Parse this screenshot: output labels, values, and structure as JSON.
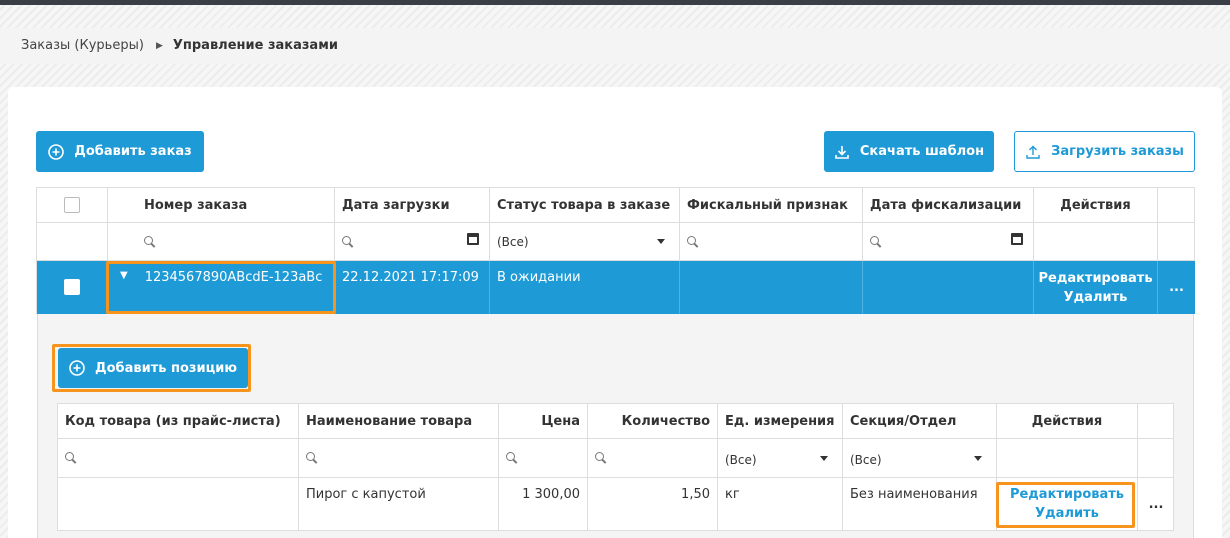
{
  "breadcrumb": {
    "parent": "Заказы (Курьеры)",
    "current": "Управление заказами"
  },
  "toolbar": {
    "add_order": "Добавить заказ",
    "download_template": "Скачать шаблон",
    "upload_orders": "Загрузить заказы"
  },
  "orders_table": {
    "columns": [
      "Номер заказа",
      "Дата загрузки",
      "Статус товара в заказе",
      "Фискальный признак",
      "Дата фискализации",
      "Действия"
    ],
    "sort_indicator": "↑",
    "status_filter": "(Все)",
    "row": {
      "order_number": "1234567890ABcdE-123aBc",
      "upload_date": "22.12.2021 17:17:09",
      "status": "В ожидании",
      "fiscal_sign": "",
      "fiscal_date": "",
      "edit": "Редактировать",
      "delete": "Удалить",
      "more": "..."
    }
  },
  "positions": {
    "add_position": "Добавить позицию",
    "columns": [
      "Код товара (из прайс-листа)",
      "Наименование товара",
      "Цена",
      "Количество",
      "Ед. измерения",
      "Секция/Отдел",
      "Действия"
    ],
    "unit_filter": "(Все)",
    "section_filter": "(Все)",
    "row": {
      "code": "",
      "name": "Пирог с капустой",
      "price": "1 300,00",
      "qty": "1,50",
      "unit": "кг",
      "section": "Без наименования",
      "edit": "Редактировать",
      "delete": "Удалить",
      "more": "..."
    }
  },
  "colors": {
    "accent": "#1e9ad6",
    "highlight": "#f7941d"
  }
}
